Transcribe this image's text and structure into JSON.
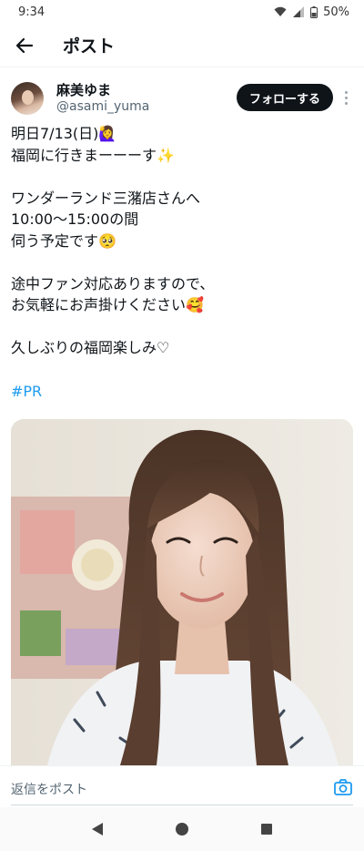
{
  "status_bar": {
    "time": "9:34",
    "battery_percent": "50%"
  },
  "header": {
    "title": "ポスト",
    "back_icon": "arrow-left-icon"
  },
  "author": {
    "display_name": "麻美ゆま",
    "handle": "@asami_yuma",
    "follow_label": "フォローする"
  },
  "tweet": {
    "lines": [
      "明日7/13(日)🙋‍♀️",
      "福岡に行きまーーーす✨",
      "",
      "ワンダーランド三潴店さんへ",
      "10:00〜15:00の間",
      "伺う予定です🥺",
      "",
      "途中ファン対応ありますので、",
      "お気軽にお声掛けください🥰",
      "",
      "久しぶりの福岡楽しみ♡"
    ],
    "hashtag": "#PR"
  },
  "reply": {
    "placeholder": "返信をポスト",
    "camera_icon": "camera-icon"
  },
  "colors": {
    "accent": "#1d9bf0",
    "text": "#0f1419",
    "secondary": "#536471",
    "follow_bg": "#0f1419"
  },
  "nav": {
    "back_icon": "triangle-back-icon",
    "home_icon": "circle-home-icon",
    "recents_icon": "square-recents-icon"
  }
}
